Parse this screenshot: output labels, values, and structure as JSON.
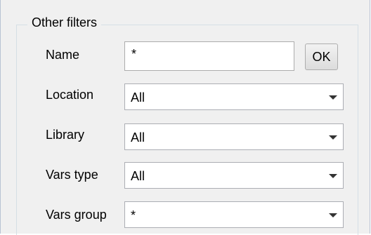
{
  "group": {
    "title": "Other filters"
  },
  "name_filter": {
    "label": "Name",
    "value": "*",
    "ok_label": "OK"
  },
  "location_filter": {
    "label": "Location",
    "value": "All",
    "icon": "chevron-down-icon"
  },
  "library_filter": {
    "label": "Library",
    "value": "All",
    "icon": "chevron-down-icon"
  },
  "vars_type_filter": {
    "label": "Vars type",
    "value": "All",
    "icon": "chevron-down-icon"
  },
  "vars_group_filter": {
    "label": "Vars group",
    "value": "*",
    "icon": "chevron-down-icon"
  }
}
